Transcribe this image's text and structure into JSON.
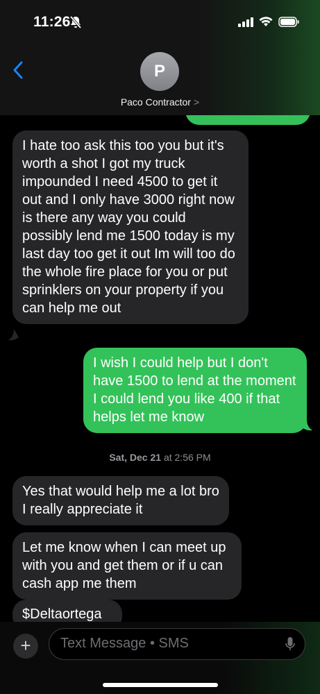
{
  "status_bar": {
    "time": "11:26"
  },
  "header": {
    "avatar_initial": "P",
    "contact_name": "Paco Contractor",
    "chevron": ">"
  },
  "messages": [
    {
      "direction": "incoming",
      "text": "I hate too ask this too you but it's worth a shot I got my truck impounded I need 4500 to get it out and I only have 3000 right now is there any way you could possibly lend me 1500 today is my last day too get it out Im will too do the whole fire place for you or put sprinklers on your property if you can help me out"
    },
    {
      "direction": "outgoing",
      "text": "I wish I could help but I don't have 1500 to lend at the moment I could lend you like 400 if that helps let me know"
    },
    {
      "direction": "incoming",
      "text": "Yes that would help me a lot bro I really appreciate it"
    },
    {
      "direction": "incoming",
      "text": "Let me know when I can meet up with you and get them or if u can cash app me them"
    },
    {
      "direction": "incoming",
      "text": "$Deltaortega"
    }
  ],
  "timestamp": {
    "day": "Sat, Dec 21",
    "time": "at 2:56 PM"
  },
  "composer": {
    "plus": "+",
    "placeholder": "Text Message • SMS"
  },
  "colors": {
    "incoming": "#262628",
    "outgoing": "#33c259",
    "background": "#000000"
  }
}
